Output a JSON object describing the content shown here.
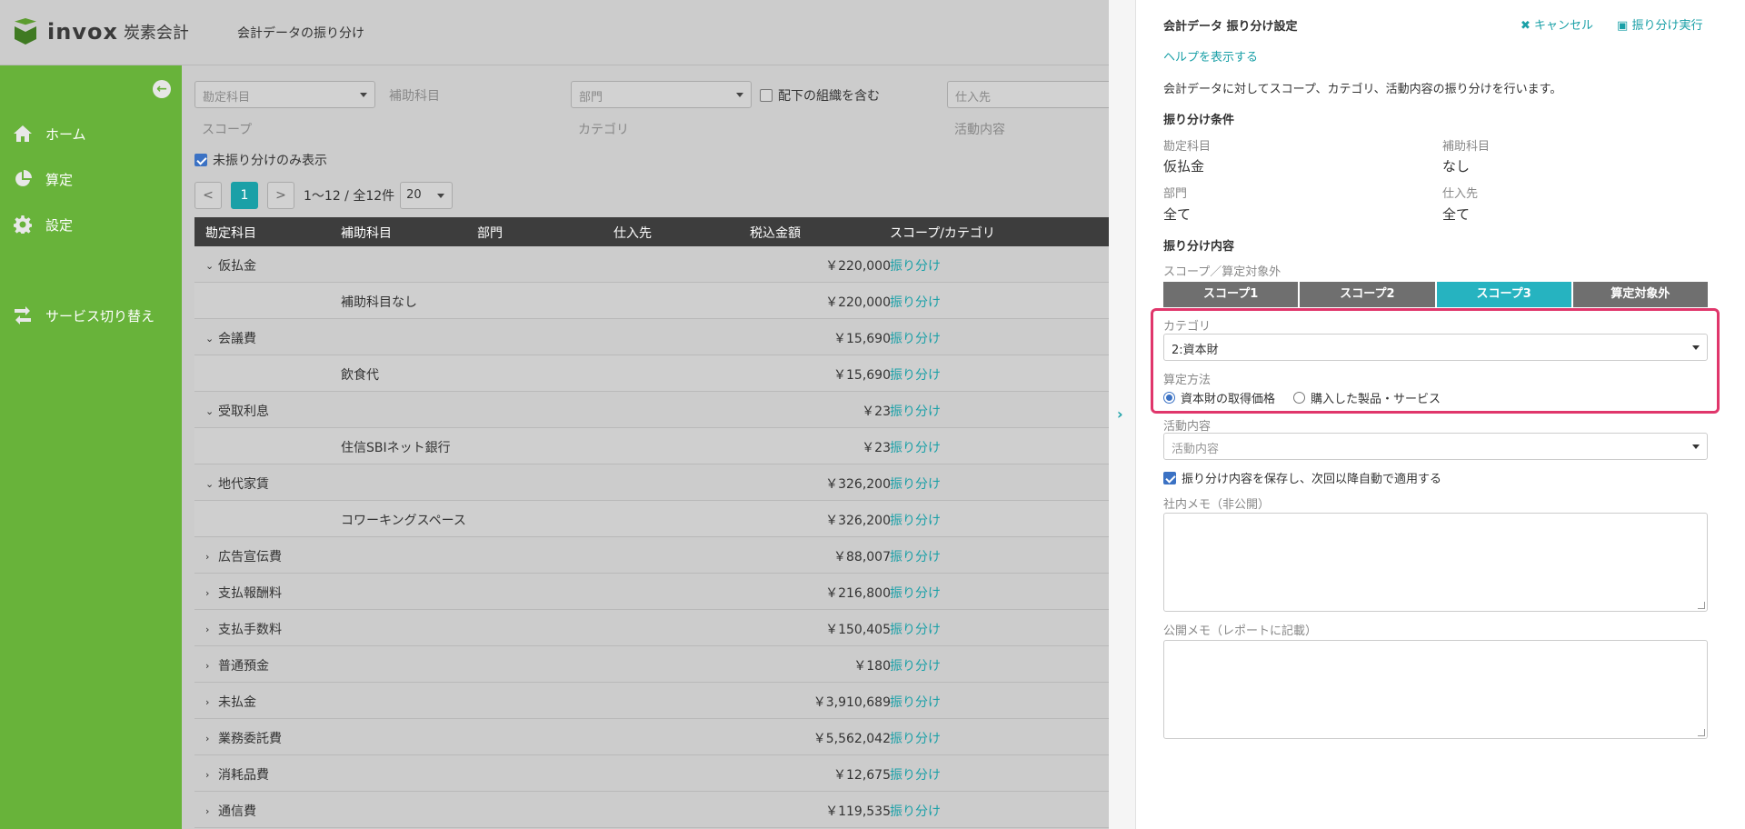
{
  "header": {
    "brand": "invox",
    "brand_sub": "炭素会計",
    "breadcrumb": "会計データの振り分け"
  },
  "sidebar": {
    "items": [
      {
        "label": "ホーム",
        "icon": "home-icon"
      },
      {
        "label": "算定",
        "icon": "pie-chart-icon"
      },
      {
        "label": "設定",
        "icon": "gear-icon"
      },
      {
        "label": "サービス切り替え",
        "icon": "switch-icon"
      }
    ]
  },
  "filters": {
    "account_placeholder": "勘定科目",
    "sub_account_label": "補助科目",
    "department_placeholder": "部門",
    "include_sub_orgs": "配下の組織を含む",
    "supplier_placeholder": "仕入先",
    "scope_label": "スコープ",
    "category_label": "カテゴリ",
    "activity_label": "活動内容",
    "unassigned_only": "未振り分けのみ表示"
  },
  "pager": {
    "prev": "<",
    "current": "1",
    "next": ">",
    "info": "1〜12 / 全12件",
    "page_size": "20"
  },
  "table": {
    "headers": [
      "勘定科目",
      "補助科目",
      "部門",
      "仕入先",
      "税込金額",
      "スコープ/カテゴリ"
    ],
    "rows": [
      {
        "account": "仮払金",
        "chevron": "⌄",
        "sub": "",
        "amount": "￥220,000",
        "action": "振り分け",
        "child": false
      },
      {
        "account": "",
        "chevron": "",
        "sub": "補助科目なし",
        "amount": "￥220,000",
        "action": "振り分け",
        "child": true
      },
      {
        "account": "会議費",
        "chevron": "⌄",
        "sub": "",
        "amount": "￥15,690",
        "action": "振り分け",
        "child": false
      },
      {
        "account": "",
        "chevron": "",
        "sub": "飲食代",
        "amount": "￥15,690",
        "action": "振り分け",
        "child": true
      },
      {
        "account": "受取利息",
        "chevron": "⌄",
        "sub": "",
        "amount": "￥23",
        "action": "振り分け",
        "child": false
      },
      {
        "account": "",
        "chevron": "",
        "sub": "住信SBIネット銀行",
        "amount": "￥23",
        "action": "振り分け",
        "child": true
      },
      {
        "account": "地代家賃",
        "chevron": "⌄",
        "sub": "",
        "amount": "￥326,200",
        "action": "振り分け",
        "child": false
      },
      {
        "account": "",
        "chevron": "",
        "sub": "コワーキングスペース",
        "amount": "￥326,200",
        "action": "振り分け",
        "child": true
      },
      {
        "account": "広告宣伝費",
        "chevron": "›",
        "sub": "",
        "amount": "￥88,007",
        "action": "振り分け",
        "child": false
      },
      {
        "account": "支払報酬料",
        "chevron": "›",
        "sub": "",
        "amount": "￥216,800",
        "action": "振り分け",
        "child": false
      },
      {
        "account": "支払手数料",
        "chevron": "›",
        "sub": "",
        "amount": "￥150,405",
        "action": "振り分け",
        "child": false
      },
      {
        "account": "普通預金",
        "chevron": "›",
        "sub": "",
        "amount": "￥180",
        "action": "振り分け",
        "child": false
      },
      {
        "account": "未払金",
        "chevron": "›",
        "sub": "",
        "amount": "￥3,910,689",
        "action": "振り分け",
        "child": false
      },
      {
        "account": "業務委託費",
        "chevron": "›",
        "sub": "",
        "amount": "￥5,562,042",
        "action": "振り分け",
        "child": false
      },
      {
        "account": "消耗品費",
        "chevron": "›",
        "sub": "",
        "amount": "￥12,675",
        "action": "振り分け",
        "child": false
      },
      {
        "account": "通信費",
        "chevron": "›",
        "sub": "",
        "amount": "￥119,535",
        "action": "振り分け",
        "child": false
      }
    ]
  },
  "panel": {
    "title": "会計データ 振り分け設定",
    "cancel": "キャンセル",
    "execute": "振り分け実行",
    "help": "ヘルプを表示する",
    "description": "会計データに対してスコープ、カテゴリ、活動内容の振り分けを行います。",
    "conditions_heading": "振り分け条件",
    "conditions": {
      "account_key": "勘定科目",
      "account_val": "仮払金",
      "sub_key": "補助科目",
      "sub_val": "なし",
      "dept_key": "部門",
      "dept_val": "全て",
      "supplier_key": "仕入先",
      "supplier_val": "全て"
    },
    "content_heading": "振り分け内容",
    "scope_label": "スコープ／算定対象外",
    "scopes": [
      "スコープ1",
      "スコープ2",
      "スコープ3",
      "算定対象外"
    ],
    "active_scope": "スコープ3",
    "category_label": "カテゴリ",
    "category_value": "2:資本財",
    "method_label": "算定方法",
    "method_options": [
      "資本財の取得価格",
      "購入した製品・サービス"
    ],
    "method_selected": "資本財の取得価格",
    "activity_label": "活動内容",
    "activity_placeholder": "活動内容",
    "save_rule": "振り分け内容を保存し、次回以降自動で適用する",
    "internal_memo_label": "社内メモ（非公開）",
    "public_memo_label": "公開メモ（レポートに記載）"
  },
  "colors": {
    "sidebar": "#68b33a",
    "accent": "#1aa0a7",
    "active_scope": "#26b3c0",
    "highlight": "#e0366b"
  }
}
